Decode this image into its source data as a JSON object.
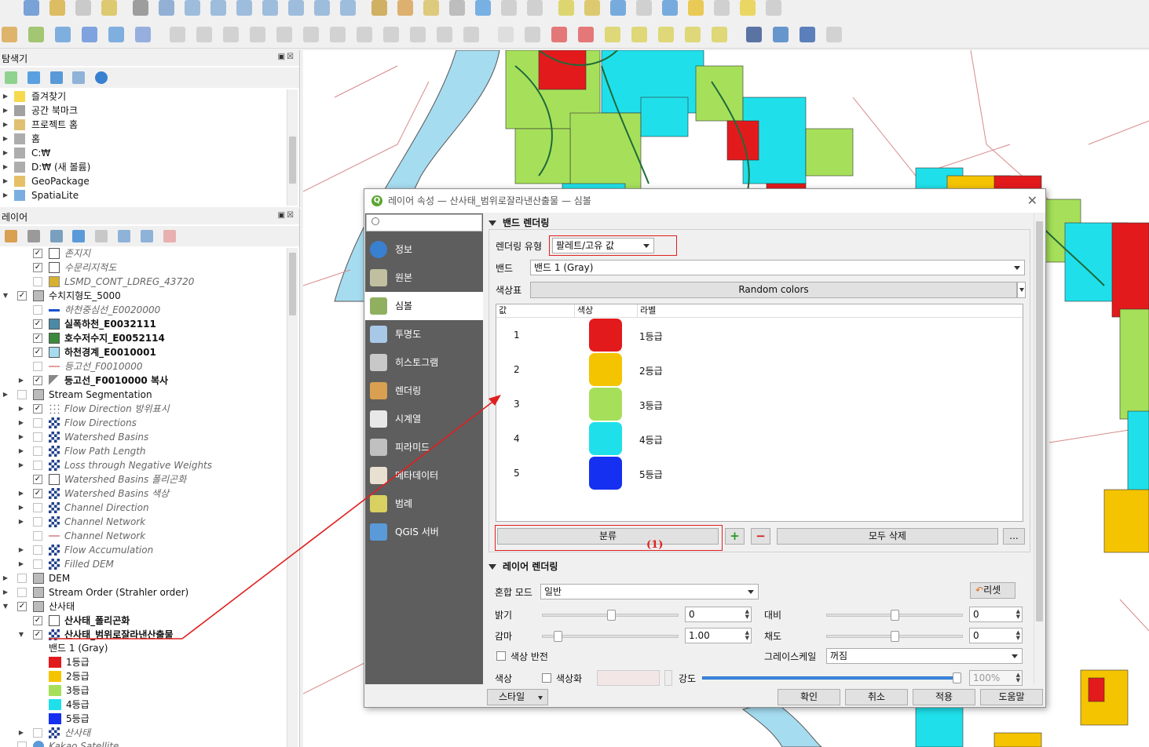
{
  "explorer": {
    "title": "탐색기",
    "items": [
      {
        "label": "즐겨찾기",
        "icon": "star-icon"
      },
      {
        "label": "공간 북마크",
        "icon": "bookmark-icon"
      },
      {
        "label": "프로젝트 홈",
        "icon": "project-home-icon"
      },
      {
        "label": "홈",
        "icon": "home-folder-icon"
      },
      {
        "label": "C:₩",
        "icon": "drive-icon"
      },
      {
        "label": "D:₩ (새 볼륨)",
        "icon": "drive-icon"
      },
      {
        "label": "GeoPackage",
        "icon": "geopackage-icon"
      },
      {
        "label": "SpatiaLite",
        "icon": "spatialite-icon"
      }
    ]
  },
  "layers_panel": {
    "title": "레이어",
    "rows": [
      {
        "label": "존지지",
        "style": "ital",
        "checked": true,
        "arrow": false,
        "indent": 1,
        "icon": "polygon"
      },
      {
        "label": "수문리지적도",
        "style": "ital",
        "checked": true,
        "arrow": false,
        "indent": 1,
        "icon": "polygon"
      },
      {
        "label": "LSMD_CONT_LDREG_43720",
        "style": "ital",
        "checked": false,
        "arrow": false,
        "indent": 1,
        "icon": "gold"
      },
      {
        "label": "수치지형도_5000",
        "style": "",
        "checked": true,
        "arrow": true,
        "indent": 0,
        "icon": "group"
      },
      {
        "label": "하천중심선_E0020000",
        "style": "ital",
        "checked": false,
        "arrow": false,
        "indent": 1,
        "icon": "line-blue"
      },
      {
        "label": "실폭하천_E0032111",
        "style": "bold",
        "checked": true,
        "arrow": false,
        "indent": 1,
        "icon": "steel"
      },
      {
        "label": "호수저수지_E0052114",
        "style": "bold",
        "checked": true,
        "arrow": false,
        "indent": 1,
        "icon": "green"
      },
      {
        "label": "하천경계_E0010001",
        "style": "bold",
        "checked": true,
        "arrow": false,
        "indent": 1,
        "icon": "lightblue"
      },
      {
        "label": "등고선_F0010000",
        "style": "ital",
        "checked": false,
        "arrow": false,
        "indent": 1,
        "icon": "line-pink"
      },
      {
        "label": "등고선_F0010000 복사",
        "style": "bold",
        "checked": true,
        "arrow": true,
        "indent": 1,
        "icon": "line-multi"
      },
      {
        "label": "Stream Segmentation",
        "style": "",
        "checked": false,
        "arrow": true,
        "indent": 0,
        "icon": "group"
      },
      {
        "label": "Flow Direction 방위표시",
        "style": "ital",
        "checked": true,
        "arrow": true,
        "indent": 1,
        "icon": "dots"
      },
      {
        "label": "Flow Directions",
        "style": "ital",
        "checked": false,
        "arrow": true,
        "indent": 1,
        "icon": "raster"
      },
      {
        "label": "Watershed Basins",
        "style": "ital",
        "checked": false,
        "arrow": true,
        "indent": 1,
        "icon": "raster"
      },
      {
        "label": "Flow Path Length",
        "style": "ital",
        "checked": false,
        "arrow": true,
        "indent": 1,
        "icon": "raster"
      },
      {
        "label": "Loss through Negative Weights",
        "style": "ital",
        "checked": false,
        "arrow": true,
        "indent": 1,
        "icon": "raster"
      },
      {
        "label": "Watershed Basins 폴리곤화",
        "style": "ital",
        "checked": true,
        "arrow": false,
        "indent": 1,
        "icon": "polygon"
      },
      {
        "label": "Watershed Basins 색상",
        "style": "ital",
        "checked": true,
        "arrow": true,
        "indent": 1,
        "icon": "raster"
      },
      {
        "label": "Channel Direction",
        "style": "ital",
        "checked": false,
        "arrow": true,
        "indent": 1,
        "icon": "raster"
      },
      {
        "label": "Channel Network",
        "style": "ital",
        "checked": false,
        "arrow": true,
        "indent": 1,
        "icon": "raster"
      },
      {
        "label": "Channel Network",
        "style": "ital",
        "checked": false,
        "arrow": false,
        "indent": 1,
        "icon": "line-pink"
      },
      {
        "label": "Flow Accumulation",
        "style": "ital",
        "checked": false,
        "arrow": true,
        "indent": 1,
        "icon": "raster"
      },
      {
        "label": "Filled DEM",
        "style": "ital",
        "checked": false,
        "arrow": true,
        "indent": 1,
        "icon": "raster"
      },
      {
        "label": "DEM",
        "style": "",
        "checked": false,
        "arrow": true,
        "indent": 0,
        "icon": "group"
      },
      {
        "label": "Stream Order (Strahler order)",
        "style": "",
        "checked": false,
        "arrow": true,
        "indent": 0,
        "icon": "group"
      },
      {
        "label": "산사태",
        "style": "",
        "checked": true,
        "arrow": true,
        "indent": 0,
        "icon": "group"
      },
      {
        "label": "산사태_폴리곤화",
        "style": "bold",
        "checked": true,
        "arrow": false,
        "indent": 1,
        "icon": "polygon"
      },
      {
        "label": "산사태_범위로잘라낸산출물",
        "style": "bold",
        "checked": true,
        "arrow": true,
        "indent": 1,
        "icon": "raster"
      }
    ],
    "legend_band": "밴드 1 (Gray)",
    "legend": [
      {
        "label": "1등급",
        "color": "#e31a1c"
      },
      {
        "label": "2등급",
        "color": "#f5c400"
      },
      {
        "label": "3등급",
        "color": "#a6e05a"
      },
      {
        "label": "4등급",
        "color": "#1fe0ea"
      },
      {
        "label": "5등급",
        "color": "#1530f0"
      }
    ],
    "after_rows": [
      {
        "label": "산사태",
        "style": "ital",
        "checked": false,
        "arrow": true,
        "indent": 1,
        "icon": "raster"
      },
      {
        "label": "Kakao Satellite",
        "style": "ital",
        "checked": false,
        "arrow": false,
        "indent": 0,
        "icon": "globe"
      }
    ]
  },
  "dialog": {
    "title": "레이어 속성 — 산사태_범위로잘라낸산출물 — 심볼",
    "side_items": [
      {
        "label": "정보",
        "icon": "info-icon"
      },
      {
        "label": "원본",
        "icon": "source-icon"
      },
      {
        "label": "심볼",
        "icon": "symbology-icon"
      },
      {
        "label": "투명도",
        "icon": "transparency-icon"
      },
      {
        "label": "히스토그램",
        "icon": "histogram-icon"
      },
      {
        "label": "렌더링",
        "icon": "rendering-icon"
      },
      {
        "label": "시계열",
        "icon": "temporal-icon"
      },
      {
        "label": "피라미드",
        "icon": "pyramids-icon"
      },
      {
        "label": "메타데이터",
        "icon": "metadata-icon"
      },
      {
        "label": "범례",
        "icon": "legend-icon"
      },
      {
        "label": "QGIS 서버",
        "icon": "qgis-server-icon"
      }
    ],
    "band_rendering": {
      "header": "밴드 렌더링",
      "render_type_label": "렌더링 유형",
      "render_type_value": "팔레트/고유 값",
      "band_label": "밴드",
      "band_value": "밴드 1 (Gray)",
      "ramp_label": "색상표",
      "ramp_value": "Random colors",
      "col_value": "값",
      "col_color": "색상",
      "col_label": "라벨",
      "classes": [
        {
          "value": "1",
          "color": "#e31a1c",
          "label": "1등급"
        },
        {
          "value": "2",
          "color": "#f5c400",
          "label": "2등급"
        },
        {
          "value": "3",
          "color": "#a6e05a",
          "label": "3등급"
        },
        {
          "value": "4",
          "color": "#1fe0ea",
          "label": "4등급"
        },
        {
          "value": "5",
          "color": "#1530f0",
          "label": "5등급"
        }
      ],
      "classify_btn": "분류",
      "delete_all_btn": "모두 삭제",
      "more_btn": "...",
      "annotation": "(1)"
    },
    "layer_rendering": {
      "header": "레이어 렌더링",
      "blend_label": "혼합 모드",
      "blend_value": "일반",
      "reset_btn": "리셋",
      "brightness_label": "밝기",
      "brightness_value": "0",
      "contrast_label": "대비",
      "contrast_value": "0",
      "gamma_label": "감마",
      "gamma_value": "1.00",
      "saturation_label": "채도",
      "saturation_value": "0",
      "invert_label": "색상 반전",
      "grayscale_label": "그레이스케일",
      "grayscale_value": "꺼짐",
      "color_label": "색상",
      "colorize_label": "색상화",
      "strength_label": "강도",
      "strength_value": "100%"
    },
    "footer": {
      "style_btn": "스타일",
      "ok_btn": "확인",
      "cancel_btn": "취소",
      "apply_btn": "적용",
      "help_btn": "도움말"
    }
  },
  "colors": {
    "annotation_red": "#e02020",
    "dialog_side": "#5e5e5e",
    "river_blue": "#a6dcf0"
  }
}
